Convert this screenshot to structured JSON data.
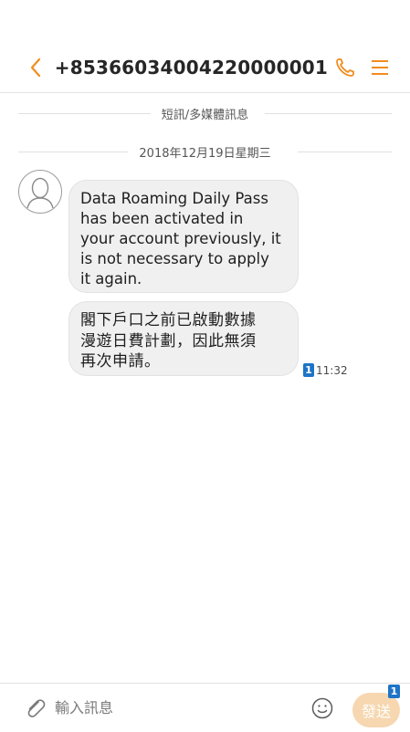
{
  "header": {
    "title": "+85366034004220000001",
    "icons": {
      "back": "chevron-left-icon",
      "call": "phone-icon",
      "menu": "menu-icon"
    },
    "accent_color": "#f28c1e"
  },
  "conversation": {
    "type_label": "短訊/多媒體訊息",
    "date_label": "2018年12月19日星期三",
    "messages": [
      {
        "text": "Data Roaming Daily Pass\nhas been activated in\nyour account previously, it\nis not necessary to apply\nit again."
      },
      {
        "text": "閣下戶口之前已啟動數據\n漫遊日費計劃，因此無須\n再次申請。"
      }
    ],
    "unread_count": "1",
    "time": "11:32",
    "avatar_icon": "person-icon"
  },
  "composer": {
    "placeholder": "輸入訊息",
    "send_label": "發送",
    "send_badge": "1",
    "icons": {
      "attach": "paperclip-icon",
      "emoji": "smiley-icon"
    },
    "send_color": "#f6d7b0"
  }
}
